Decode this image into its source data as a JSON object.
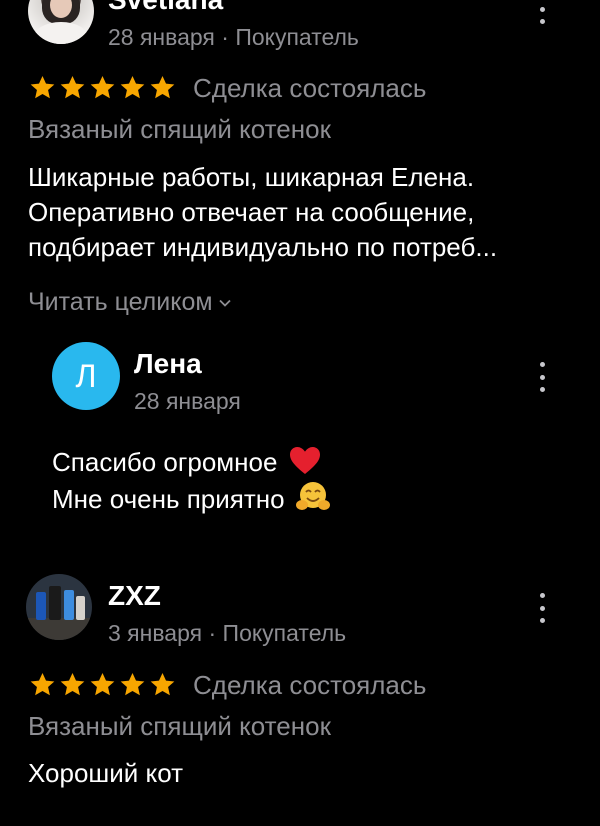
{
  "reviews": [
    {
      "author": "Svetlana",
      "date": "28 января",
      "role": "Покупатель",
      "rating": 5,
      "deal_status": "Сделка состоялась",
      "product": "Вязаный спящий котенок",
      "text_lines": [
        "Шикарные работы, шикарная Елена.",
        "Оперативно отвечает на сообщение,",
        "подбирает индивидуально по потреб..."
      ],
      "read_more": "Читать целиком",
      "reply": {
        "author": "Лена",
        "avatar_letter": "Л",
        "date": "28 января",
        "text_lines": [
          "Спасибо огромное",
          "Мне очень приятно"
        ]
      }
    },
    {
      "author": "ZXZ",
      "date": "3 января",
      "role": "Покупатель",
      "rating": 5,
      "deal_status": "Сделка состоялась",
      "product": "Вязаный спящий котенок",
      "text_lines": [
        "Хороший кот"
      ]
    }
  ],
  "meta_separator": "·",
  "colors": {
    "background": "#000000",
    "star": "#f7a600",
    "secondary_text": "#8e8e93",
    "avatar_letter_bg": "#29b8ee",
    "heart": "#e5202e",
    "hug_emoji": "#f6c33a"
  },
  "icons": {
    "star": "star-icon",
    "more": "more-vertical-icon",
    "chevron": "chevron-down-icon",
    "heart": "heart-emoji",
    "hug": "hugging-face-emoji"
  }
}
